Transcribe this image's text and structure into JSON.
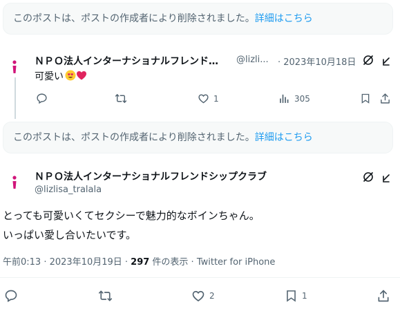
{
  "notice_top": {
    "text": "このポストは、ポストの作成者により削除されました。",
    "link": "詳細はこちら"
  },
  "reply": {
    "name": "ＮＰＯ法人インターナショナルフレンド…",
    "handle": "@lizli...",
    "date": "· 2023年10月18日",
    "text": "可愛い",
    "emojis": [
      "heart-eyes-emoji",
      "red-heart-emoji"
    ],
    "actions": {
      "reply_count": "",
      "retweet_count": "",
      "like_count": "1",
      "views_count": "305"
    }
  },
  "notice_mid": {
    "text": "このポストは、ポストの作成者により削除されました。",
    "link": "詳細はこちら"
  },
  "main": {
    "name": "ＮＰＯ法人インターナショナルフレンドシップクラブ",
    "handle": "@lizlisa_tralala",
    "line1": "とっても可愛いくてセクシーで魅力的なボインちゃん。",
    "line2": "いっぱい愛し合いたいです。",
    "meta_time": "午前0:13 · 2023年10月19日 · ",
    "meta_views": "297",
    "meta_views_suffix": " 件の表示 · Twitter for iPhone",
    "actions": {
      "reply_count": "",
      "retweet_count": "",
      "like_count": "2",
      "bookmark_count": "1"
    }
  },
  "colors": {
    "link": "#1d9bf0",
    "muted": "#536471",
    "text": "#0f1419",
    "avatar_accent": "#d1157a"
  }
}
